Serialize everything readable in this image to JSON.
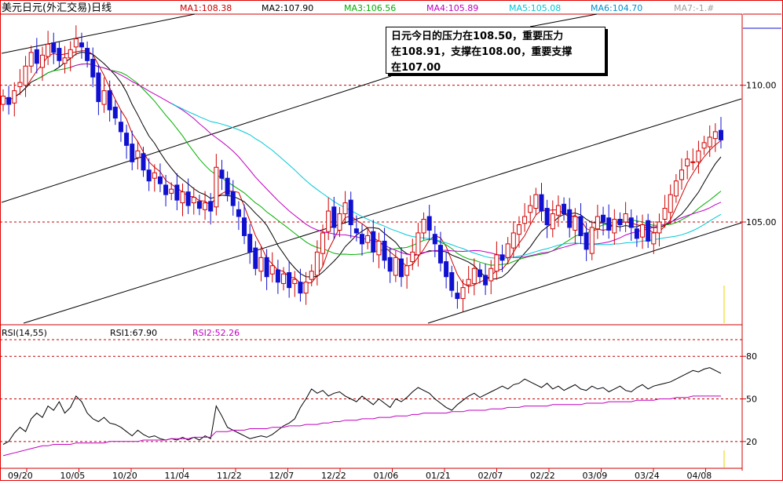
{
  "chart_data": {
    "type": "candlestick",
    "title": "美元日元(外汇交易)日线",
    "ma_values": [
      {
        "label": "MA1:108.38",
        "color": "#d00000"
      },
      {
        "label": "MA2:107.90",
        "color": "#000000"
      },
      {
        "label": "MA3:106.56",
        "color": "#00b000"
      },
      {
        "label": "MA4:105.89",
        "color": "#c000c0"
      },
      {
        "label": "MA5:105.08",
        "color": "#00c8d8"
      },
      {
        "label": "MA6:104.70",
        "color": "#0090d0"
      },
      {
        "label": "MA7:-1.#",
        "color": "#a0a0a0"
      }
    ],
    "price_axis": {
      "ticks": [
        "110.00",
        "105.00"
      ],
      "ylim": [
        101.3,
        112.6
      ]
    },
    "rsi_header": {
      "name": "RSI(14,55)",
      "rsi1": "RSI1:67.90",
      "rsi2": "RSI2:52.26"
    },
    "rsi_axis": {
      "ticks": [
        "80",
        "50",
        "20"
      ],
      "ylim": [
        5,
        100
      ]
    },
    "x_labels": [
      "09/20",
      "10/05",
      "10/20",
      "11/04",
      "11/22",
      "12/07",
      "12/22",
      "01/06",
      "01/21",
      "02/07",
      "02/22",
      "03/09",
      "03/24",
      "04/08"
    ],
    "annotation": [
      "日元今日的压力在108.50，重要压力",
      "在108.91，支撑在108.00，重要支撑",
      "在107.00"
    ],
    "colors": {
      "up": "#d00000",
      "down": "#1010d0",
      "grid": "#c00000",
      "axis": "#d00000",
      "rsi1": "#000000",
      "rsi2": "#c000c0"
    },
    "price_closes": [
      109.6,
      109.3,
      109.8,
      110.1,
      110.7,
      111.2,
      110.8,
      111.1,
      111.5,
      111.2,
      110.9,
      111.0,
      111.3,
      111.7,
      111.4,
      110.9,
      110.3,
      109.4,
      109.8,
      109.1,
      108.8,
      108.3,
      107.8,
      107.2,
      107.6,
      106.9,
      106.5,
      106.8,
      106.4,
      106.0,
      106.2,
      105.8,
      106.1,
      105.6,
      105.9,
      105.5,
      105.7,
      105.4,
      107.0,
      106.6,
      106.0,
      105.6,
      105.2,
      104.5,
      103.9,
      103.3,
      103.7,
      103.0,
      103.4,
      102.8,
      103.1,
      102.6,
      102.9,
      102.4,
      102.8,
      103.2,
      103.9,
      104.6,
      105.4,
      104.8,
      105.3,
      105.7,
      104.9,
      104.6,
      104.2,
      104.5,
      103.9,
      104.3,
      103.6,
      103.2,
      103.7,
      103.0,
      103.4,
      103.9,
      104.6,
      105.1,
      104.7,
      104.2,
      103.5,
      103.0,
      102.5,
      102.2,
      102.6,
      102.9,
      103.3,
      103.0,
      102.7,
      103.3,
      103.8,
      103.6,
      104.2,
      104.6,
      104.9,
      105.2,
      105.6,
      106.0,
      105.4,
      104.9,
      105.3,
      105.6,
      105.3,
      104.8,
      105.2,
      104.5,
      104.0,
      104.8,
      105.2,
      105.0,
      104.7,
      105.1,
      104.9,
      105.3,
      104.8,
      104.4,
      104.9,
      104.3,
      104.6,
      105.0,
      105.5,
      106.0,
      106.5,
      106.9,
      107.3,
      107.2,
      107.6,
      107.9,
      108.1,
      108.3,
      108.0
    ],
    "price_ohlc_style": "daily candlesticks with MA1..MA6 overlays and regression channel lines",
    "rsi1_values": [
      18,
      20,
      26,
      30,
      27,
      36,
      40,
      37,
      45,
      42,
      48,
      40,
      44,
      52,
      48,
      40,
      36,
      34,
      37,
      33,
      32,
      30,
      27,
      24,
      28,
      25,
      23,
      24,
      22,
      21,
      22,
      21,
      23,
      21,
      23,
      21,
      24,
      22,
      45,
      38,
      30,
      28,
      26,
      24,
      22,
      23,
      24,
      23,
      25,
      28,
      31,
      33,
      36,
      44,
      50,
      57,
      54,
      56,
      52,
      54,
      55,
      52,
      50,
      48,
      52,
      49,
      46,
      50,
      47,
      44,
      50,
      48,
      51,
      55,
      58,
      56,
      54,
      50,
      47,
      44,
      42,
      46,
      49,
      52,
      54,
      51,
      53,
      55,
      57,
      59,
      57,
      60,
      61,
      64,
      62,
      60,
      58,
      61,
      57,
      59,
      56,
      58,
      60,
      57,
      56,
      59,
      57,
      58,
      55,
      57,
      59,
      56,
      55,
      58,
      60,
      57,
      59,
      60,
      61,
      62,
      64,
      66,
      68,
      70,
      69,
      71,
      72,
      70,
      68
    ],
    "rsi2_values": [
      10,
      11,
      12,
      13,
      14,
      15,
      16,
      17,
      17,
      18,
      18,
      18,
      18,
      19,
      19,
      19,
      19,
      19,
      19,
      20,
      20,
      20,
      20,
      20,
      20,
      21,
      21,
      21,
      21,
      21,
      22,
      22,
      22,
      22,
      23,
      23,
      23,
      23,
      27,
      27,
      27,
      28,
      28,
      28,
      29,
      29,
      29,
      29,
      30,
      30,
      30,
      31,
      31,
      31,
      32,
      32,
      32,
      33,
      33,
      34,
      34,
      35,
      35,
      35,
      36,
      36,
      36,
      37,
      37,
      37,
      38,
      38,
      38,
      39,
      39,
      40,
      40,
      40,
      40,
      40,
      41,
      41,
      41,
      42,
      42,
      42,
      42,
      43,
      43,
      43,
      44,
      44,
      44,
      45,
      45,
      45,
      45,
      45,
      46,
      46,
      46,
      46,
      46,
      46,
      47,
      47,
      47,
      47,
      48,
      48,
      48,
      48,
      48,
      49,
      49,
      49,
      49,
      50,
      50,
      50,
      51,
      51,
      51,
      52,
      52,
      52,
      52,
      52,
      52
    ]
  }
}
